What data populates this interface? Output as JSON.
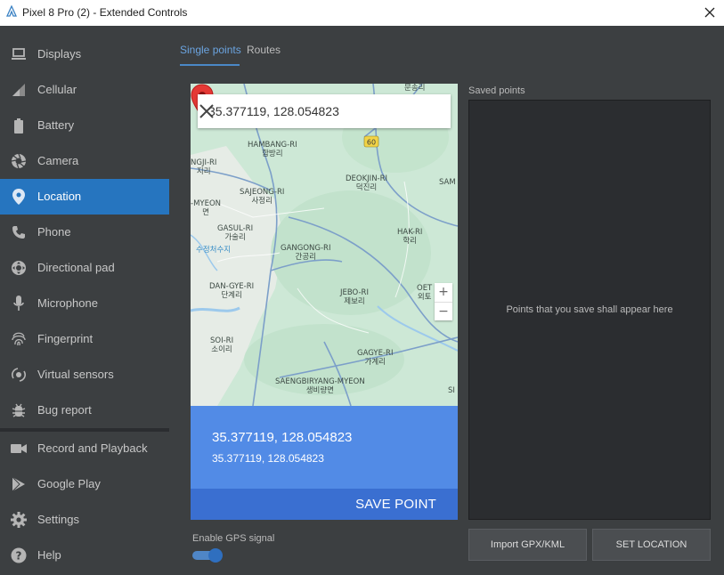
{
  "window": {
    "title": "Pixel 8 Pro (2) - Extended Controls"
  },
  "sidebar": {
    "items": [
      {
        "label": "Displays",
        "icon": "display-icon"
      },
      {
        "label": "Cellular",
        "icon": "signal-icon"
      },
      {
        "label": "Battery",
        "icon": "battery-icon"
      },
      {
        "label": "Camera",
        "icon": "camera-icon"
      },
      {
        "label": "Location",
        "icon": "location-pin-icon",
        "active": true
      },
      {
        "label": "Phone",
        "icon": "phone-icon"
      },
      {
        "label": "Directional pad",
        "icon": "dpad-icon"
      },
      {
        "label": "Microphone",
        "icon": "microphone-icon"
      },
      {
        "label": "Fingerprint",
        "icon": "fingerprint-icon"
      },
      {
        "label": "Virtual sensors",
        "icon": "sensors-icon"
      },
      {
        "label": "Bug report",
        "icon": "bug-icon"
      },
      {
        "label": "Record and Playback",
        "icon": "video-icon"
      },
      {
        "label": "Google Play",
        "icon": "play-icon"
      },
      {
        "label": "Settings",
        "icon": "gear-icon"
      },
      {
        "label": "Help",
        "icon": "help-icon"
      }
    ]
  },
  "tabs": [
    {
      "label": "Single points",
      "active": true
    },
    {
      "label": "Routes",
      "active": false
    }
  ],
  "map": {
    "search_value": "35.377119, 128.054823",
    "zoom_in": "+",
    "zoom_out": "−",
    "road_badge": "60",
    "places": [
      {
        "en": "",
        "ko": "문송리"
      },
      {
        "en": "HAMBANG-RI",
        "ko": "함방리"
      },
      {
        "en": "NGJI-RI",
        "ko": "지리"
      },
      {
        "en": "DEOKJIN-RI",
        "ko": "덕진리"
      },
      {
        "en": "SAM",
        "ko": ""
      },
      {
        "en": "SAJEONG-RI",
        "ko": "사정리"
      },
      {
        "en": "-MYEON",
        "ko": "면"
      },
      {
        "en": "GASUL-RI",
        "ko": "가술리"
      },
      {
        "en": "HAK-RI",
        "ko": "학리"
      },
      {
        "en": "GANGONG-RI",
        "ko": "간공리"
      },
      {
        "en": "",
        "ko": "수정처수지"
      },
      {
        "en": "DAN-GYE-RI",
        "ko": "단계리"
      },
      {
        "en": "JEBO-RI",
        "ko": "제보리"
      },
      {
        "en": "OET",
        "ko": "외토"
      },
      {
        "en": "SOI-RI",
        "ko": "소이리"
      },
      {
        "en": "GAGYE-RI",
        "ko": "가계리"
      },
      {
        "en": "SAENGBIRYANG-MYEON",
        "ko": "생비량면"
      },
      {
        "en": "SI",
        "ko": ""
      }
    ]
  },
  "location": {
    "title": "35.377119, 128.054823",
    "subtitle": "35.377119, 128.054823",
    "save_label": "SAVE POINT"
  },
  "gps": {
    "label": "Enable GPS signal",
    "enabled": true
  },
  "saved_points": {
    "label": "Saved points",
    "empty_text": "Points that you save shall appear here"
  },
  "buttons": {
    "import_label": "Import GPX/KML",
    "set_location_label": "SET LOCATION"
  },
  "colors": {
    "accent": "#2675bf",
    "coords_panel": "#528be6",
    "save_bar": "#3a6fd1",
    "pin": "#e53935"
  }
}
